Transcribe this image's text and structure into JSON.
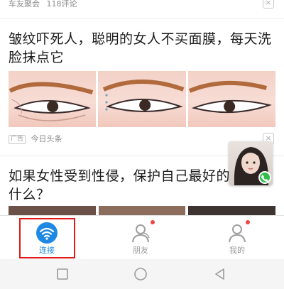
{
  "article1": {
    "source": "车友聚会",
    "comments": "118评论",
    "title": "皱纹吓死人，聪明的女人不买面膜，每天洗脸抹点它",
    "ad_label": "广告",
    "publisher": "今日头条"
  },
  "article2": {
    "title": "如果女性受到性侵，保护自己最好的方法是什么？"
  },
  "dismiss_glyph": "×",
  "tabbar": {
    "tabs": [
      {
        "label": "连接",
        "icon": "wifi-icon",
        "active": true
      },
      {
        "label": "朋友",
        "icon": "person-icon",
        "active": false
      },
      {
        "label": "我的",
        "icon": "person-icon",
        "active": false
      }
    ]
  },
  "nav": {
    "buttons": [
      "recent-apps-square-icon",
      "home-circle-icon",
      "back-triangle-icon"
    ]
  },
  "colors": {
    "accent": "#1e88e5",
    "highlight": "#e11919",
    "notification_dot": "#f04545",
    "call_badge": "#2fbf4b"
  }
}
